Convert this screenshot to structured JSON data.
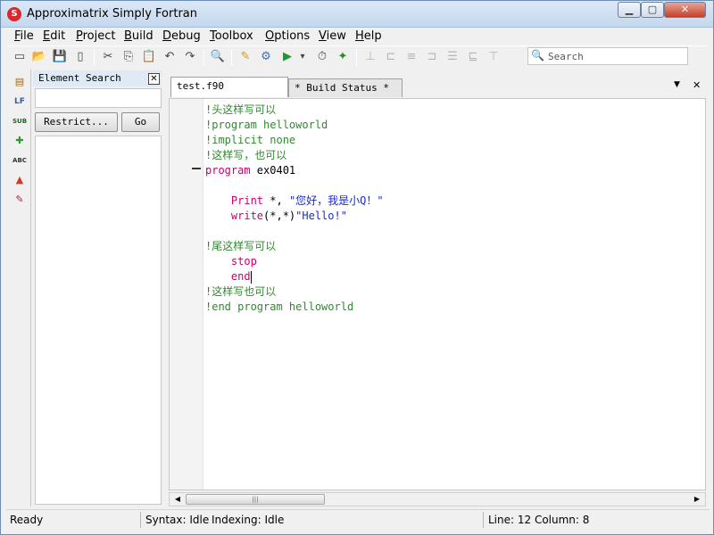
{
  "window": {
    "title": "Approximatrix Simply Fortran",
    "app_icon_glyph": "S",
    "minimize_glyph": "▁",
    "maximize_glyph": "▢",
    "close_glyph": "✕"
  },
  "menu": {
    "items": [
      {
        "label": "File"
      },
      {
        "label": "Edit"
      },
      {
        "label": "Project"
      },
      {
        "label": "Build"
      },
      {
        "label": "Debug"
      },
      {
        "label": "Toolbox"
      },
      {
        "label": "Options"
      },
      {
        "label": "View"
      },
      {
        "label": "Help"
      }
    ]
  },
  "toolbar": {
    "search_placeholder": "Search",
    "search_icon": "🔍",
    "icons": {
      "new": "▭",
      "open": "📂",
      "save": "💾",
      "close_file": "▯",
      "cut": "✂",
      "copy": "⎘",
      "paste": "📋",
      "undo": "↶",
      "redo": "↷",
      "find": "🔍",
      "build": "✎",
      "settings": "⚙",
      "run": "▶",
      "run_dropdown": "▾",
      "profile": "⏱",
      "debug": "✦",
      "step1": "⊥",
      "step2": "⊏",
      "step3": "≡",
      "step4": "⊐",
      "step5": "☰",
      "step6": "⊑",
      "step7": "⊤"
    }
  },
  "leftbar": {
    "icons": {
      "project": "▤",
      "outline": "LF",
      "subroutine": "SUB",
      "module": "✚",
      "spell": "ABC",
      "shapes": "▲",
      "pencil": "✎"
    }
  },
  "panel": {
    "title": "Element Search",
    "close_glyph": "✕",
    "input_value": "",
    "restrict_label": "Restrict...",
    "go_label": "Go"
  },
  "editor": {
    "tabs": [
      {
        "label": "test.f90",
        "active": true
      },
      {
        "label": "* Build Status *",
        "active": false
      }
    ],
    "tab_menu_glyph": "▼",
    "tab_close_glyph": "✕",
    "lines": [
      {
        "parts": [
          {
            "t": "!头这样写可以",
            "c": "c"
          }
        ]
      },
      {
        "parts": [
          {
            "t": "!program helloworld",
            "c": "c"
          }
        ]
      },
      {
        "parts": [
          {
            "t": "!implicit none",
            "c": "c"
          }
        ]
      },
      {
        "parts": [
          {
            "t": "!这样写，也可以",
            "c": "c"
          }
        ]
      },
      {
        "parts": [
          {
            "t": "program ",
            "c": "k"
          },
          {
            "t": "ex0401",
            "c": "n"
          }
        ]
      },
      {
        "parts": []
      },
      {
        "parts": [
          {
            "t": "    Print ",
            "c": "k"
          },
          {
            "t": "*, ",
            "c": "n"
          },
          {
            "t": "\"您好，我是小Q！\"",
            "c": "s"
          }
        ]
      },
      {
        "parts": [
          {
            "t": "    write",
            "c": "k"
          },
          {
            "t": "(*,*)",
            "c": "n"
          },
          {
            "t": "\"Hello!\"",
            "c": "s"
          }
        ]
      },
      {
        "parts": []
      },
      {
        "parts": [
          {
            "t": "!尾这样写可以",
            "c": "c"
          }
        ]
      },
      {
        "parts": [
          {
            "t": "    stop",
            "c": "k"
          }
        ]
      },
      {
        "parts": [
          {
            "t": "    end",
            "c": "k"
          }
        ],
        "cursor": true
      },
      {
        "parts": [
          {
            "t": "!这样写也可以",
            "c": "c"
          }
        ]
      },
      {
        "parts": [
          {
            "t": "!end program helloworld",
            "c": "c"
          }
        ]
      }
    ],
    "hscroll": {
      "left": "◀",
      "right": "▶",
      "grip": "|||"
    }
  },
  "status": {
    "ready": "Ready",
    "syntax": "Syntax: Idle",
    "indexing": "Indexing: Idle",
    "position": "Line: 12 Column: 8"
  },
  "colors": {
    "comment": "#2e8b2e",
    "keyword": "#c8006e",
    "string": "#1a2ad0"
  }
}
